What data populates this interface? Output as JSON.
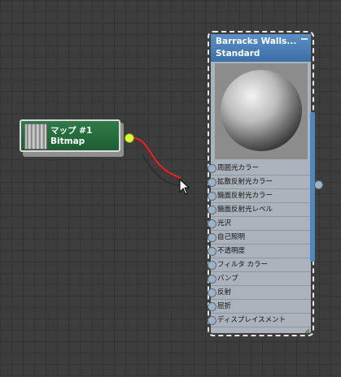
{
  "bitmap_node": {
    "title": "マップ #1",
    "subtitle": "Bitmap"
  },
  "material_node": {
    "title": "Barracks Walls...",
    "type": "Standard",
    "slots": [
      "周囲光カラー",
      "拡散反射光カラー",
      "鏡面反射光カラー",
      "鏡面反射光レベル",
      "光沢",
      "自己照明",
      "不透明度",
      "フィルタ カラー",
      "バンプ",
      "反射",
      "屈折",
      "ディスプレイスメント"
    ]
  },
  "colors": {
    "bitmap_node": "#2a6e3f",
    "material_header": "#4a7fb5",
    "wire_active": "#e0202a",
    "output_socket": "#d8ff3a"
  }
}
